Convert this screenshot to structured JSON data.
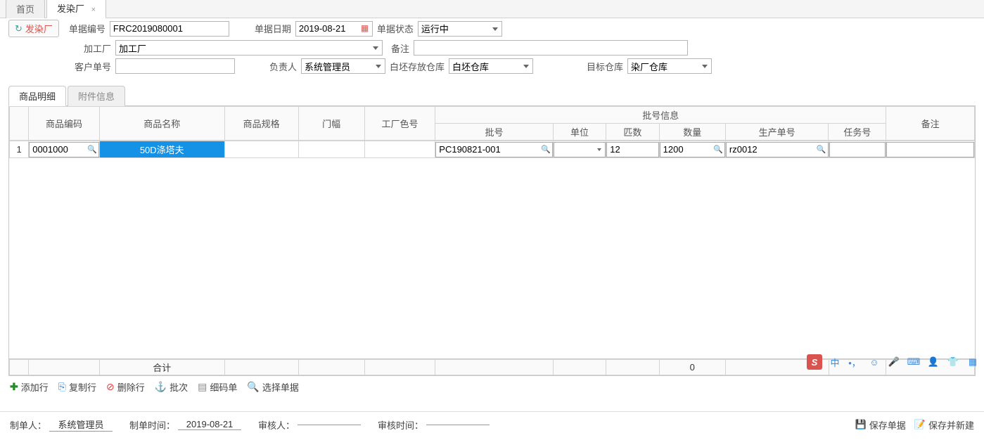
{
  "tabs": {
    "home": "首页",
    "dye": "发染厂"
  },
  "toolbar": {
    "dye_btn": "发染厂"
  },
  "form": {
    "doc_no_lbl": "单据编号",
    "doc_no": "FRC2019080001",
    "doc_date_lbl": "单据日期",
    "doc_date": "2019-08-21",
    "doc_state_lbl": "单据状态",
    "doc_state": "运行中",
    "factory_lbl": "加工厂",
    "factory": "加工厂",
    "remark_lbl": "备注",
    "remark": "",
    "cust_no_lbl": "客户单号",
    "cust_no": "",
    "person_lbl": "负责人",
    "person": "系统管理员",
    "raw_wh_lbl": "白坯存放仓库",
    "raw_wh": "白坯仓库",
    "target_wh_lbl": "目标仓库",
    "target_wh": "染厂仓库"
  },
  "subtabs": {
    "detail": "商品明细",
    "attach": "附件信息"
  },
  "grid": {
    "headers": {
      "code": "商品编码",
      "name": "商品名称",
      "spec": "商品规格",
      "width": "门幅",
      "color": "工厂色号",
      "batch_group": "批号信息",
      "batch": "批号",
      "unit": "单位",
      "bolt": "匹数",
      "qty": "数量",
      "prod_no": "生产单号",
      "task_no": "任务号",
      "note": "备注"
    },
    "rows": [
      {
        "idx": "1",
        "code": "0001000",
        "name": "50D涤塔夫",
        "spec": "",
        "width": "",
        "color": "",
        "batch": "PC190821-001",
        "unit": "",
        "bolt": "12",
        "qty": "1200",
        "prod_no": "rz0012",
        "task_no": "",
        "note": ""
      }
    ],
    "footer": {
      "label": "合计",
      "qty_total": "0"
    }
  },
  "actions": {
    "add": "添加行",
    "copy": "复制行",
    "del": "删除行",
    "batch": "批次",
    "code": "细码单",
    "pick": "选择单据"
  },
  "footer": {
    "maker_lbl": "制单人：",
    "maker": "系统管理员",
    "make_time_lbl": "制单时间：",
    "make_time": "2019-08-21",
    "auditor_lbl": "审核人：",
    "auditor": "",
    "audit_time_lbl": "审核时间：",
    "audit_time": "",
    "save": "保存单据",
    "save_new": "保存并新建"
  },
  "ime": {
    "logo": "S",
    "zh": "中"
  }
}
